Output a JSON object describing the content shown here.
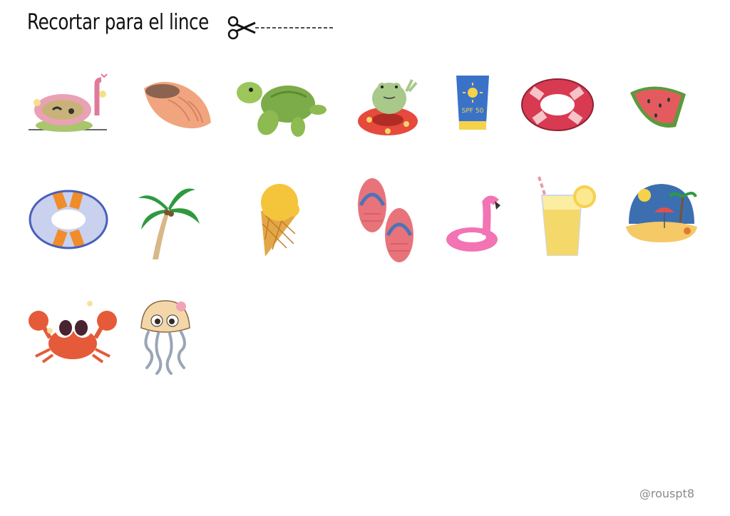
{
  "header": {
    "title": "Recortar para el lince",
    "cut_icon": "scissors-icon"
  },
  "stickers": [
    {
      "icon": "snorkel-mask-icon"
    },
    {
      "icon": "seashell-icon"
    },
    {
      "icon": "sea-turtle-icon"
    },
    {
      "icon": "frog-on-float-icon"
    },
    {
      "icon": "sunscreen-icon",
      "label": "SPF 50"
    },
    {
      "icon": "red-swim-ring-icon"
    },
    {
      "icon": "watermelon-slice-icon"
    },
    {
      "icon": "blue-swim-ring-icon"
    },
    {
      "icon": "palm-tree-icon"
    },
    {
      "icon": "ice-cream-cone-icon"
    },
    {
      "icon": "flip-flops-icon"
    },
    {
      "icon": "flamingo-float-icon"
    },
    {
      "icon": "lemonade-glass-icon"
    },
    {
      "icon": "beach-scene-icon"
    },
    {
      "icon": "crab-icon"
    },
    {
      "icon": "jellyfish-icon"
    }
  ],
  "footer": {
    "credit": "@rouspt8"
  }
}
